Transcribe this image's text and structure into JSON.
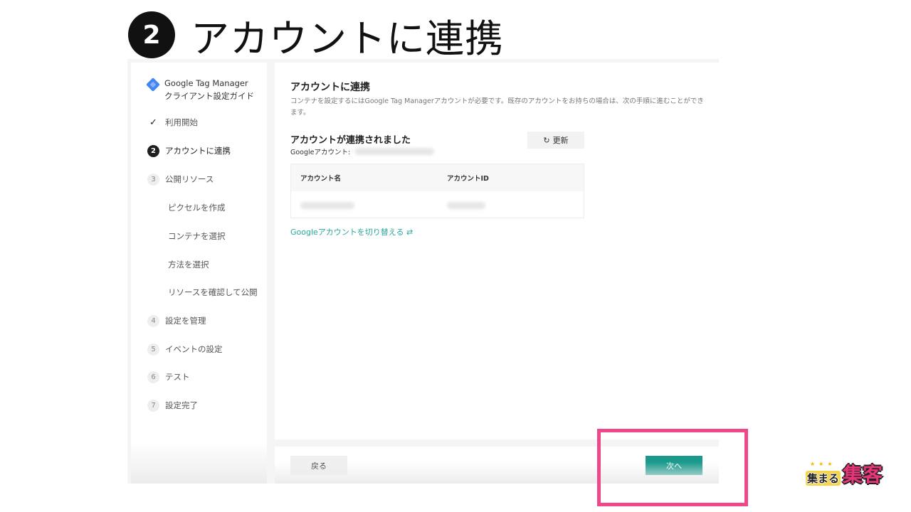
{
  "slide": {
    "step_number": "2",
    "title": "アカウントに連携"
  },
  "sidebar": {
    "guide_title": "Google Tag Managerクライアント設定ガイド",
    "guide_icon": "gtm-diamond-icon",
    "steps": [
      {
        "marker": "✓",
        "label": "利用開始",
        "state": "done"
      },
      {
        "marker": "2",
        "label": "アカウントに連携",
        "state": "active"
      },
      {
        "marker": "3",
        "label": "公開リソース",
        "state": "pending"
      },
      {
        "marker": "4",
        "label": "設定を管理",
        "state": "pending"
      },
      {
        "marker": "5",
        "label": "イベントの設定",
        "state": "pending"
      },
      {
        "marker": "6",
        "label": "テスト",
        "state": "pending"
      },
      {
        "marker": "7",
        "label": "設定完了",
        "state": "pending"
      }
    ],
    "substeps": [
      "ピクセルを作成",
      "コンテナを選択",
      "方法を選択",
      "リソースを確認して公開"
    ]
  },
  "main": {
    "title": "アカウントに連携",
    "description": "コンテナを設定するにはGoogle Tag Managerアカウントが必要です。既存のアカウントをお持ちの場合は、次の手順に進むことができます。",
    "linked_title": "アカウントが連携されました",
    "google_account_label": "Googleアカウント:",
    "refresh_icon": "↻",
    "refresh_label": "更新",
    "table": {
      "headers": [
        "アカウント名",
        "アカウントID"
      ]
    },
    "switch_link": "Googleアカウントを切り替える ⇄"
  },
  "footer": {
    "back_label": "戻る",
    "next_label": "次へ"
  },
  "logo": {
    "stars": "★★★",
    "text1": "集まる",
    "text2": "集客"
  },
  "colors": {
    "accent": "#1a9a8c",
    "link": "#26a69a",
    "highlight": "#f0478a"
  }
}
